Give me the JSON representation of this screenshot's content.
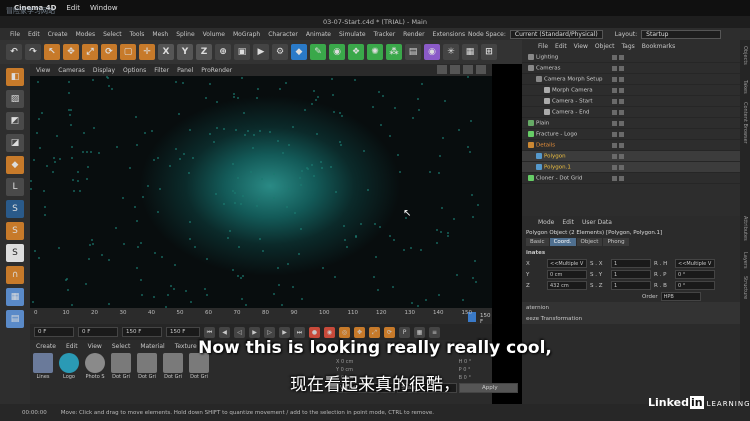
{
  "mac_menu": {
    "items": [
      "Cinema 4D",
      "Edit",
      "Window"
    ],
    "watermark": "冒险家学习网站"
  },
  "window_title": "03-07-Start.c4d * (TRIAL) - Main",
  "menu": {
    "items": [
      "File",
      "Edit",
      "Create",
      "Modes",
      "Select",
      "Tools",
      "Mesh",
      "Spline",
      "Volume",
      "MoGraph",
      "Character",
      "Animate",
      "Simulate",
      "Tracker",
      "Render",
      "Extensions"
    ],
    "node_space_label": "Node Space:",
    "node_space_value": "Current (Standard/Physical)",
    "layout_label": "Layout:",
    "layout_value": "Startup"
  },
  "toolbar": {
    "x": "X",
    "y": "Y",
    "z": "Z"
  },
  "viewport": {
    "menu": [
      "View",
      "Cameras",
      "Display",
      "Options",
      "Filter",
      "Panel",
      "ProRender"
    ]
  },
  "timeline": {
    "ticks": [
      "0",
      "10",
      "20",
      "30",
      "40",
      "50",
      "60",
      "70",
      "80",
      "90",
      "100",
      "110",
      "120",
      "130",
      "140",
      "150"
    ],
    "end_label": "150 F"
  },
  "playback": {
    "current": "0 F",
    "start": "0 F",
    "end": "150 F",
    "end2": "150 F"
  },
  "materials": {
    "menu": [
      "Create",
      "Edit",
      "View",
      "Select",
      "Material",
      "Texture"
    ],
    "items": [
      {
        "name": "Lines",
        "color": "#6a7a9a"
      },
      {
        "name": "Logo",
        "color": "#2a9ab5"
      },
      {
        "name": "Photo S",
        "color": "#8a8a8a"
      },
      {
        "name": "Dot Gri",
        "color": "#7a7a7a"
      },
      {
        "name": "Dot Gri",
        "color": "#7a7a7a"
      },
      {
        "name": "Dot Gri",
        "color": "#7a7a7a"
      },
      {
        "name": "Dot Gri",
        "color": "#7a7a7a"
      }
    ]
  },
  "coords": {
    "x": "X 0 cm",
    "y": "Y 0 cm",
    "z": "Z 0 cm",
    "h": "H 0 °",
    "p": "P 0 °",
    "b": "B 0 °",
    "world": "World",
    "scale": "Scale",
    "apply": "Apply"
  },
  "status": {
    "time": "00:00:00",
    "message": "Move: Click and drag to move elements. Hold down SHIFT to quantize movement / add to the selection in point mode, CTRL to remove."
  },
  "objects": {
    "menu": [
      "File",
      "Edit",
      "View",
      "Object",
      "Tags",
      "Bookmarks"
    ],
    "rows": [
      {
        "name": "Lighting",
        "indent": 0,
        "color": "#888"
      },
      {
        "name": "Cameras",
        "indent": 0,
        "color": "#888"
      },
      {
        "name": "Camera Morph Setup",
        "indent": 1,
        "color": "#888"
      },
      {
        "name": "Morph Camera",
        "indent": 2,
        "color": "#aaa"
      },
      {
        "name": "Camera - Start",
        "indent": 2,
        "color": "#aaa"
      },
      {
        "name": "Camera - End",
        "indent": 2,
        "color": "#aaa"
      },
      {
        "name": "Plain",
        "indent": 0,
        "color": "#6a6"
      },
      {
        "name": "Fracture - Logo",
        "indent": 0,
        "color": "#6c6"
      },
      {
        "name": "Details",
        "indent": 0,
        "color": "#c83"
      },
      {
        "name": "Polygon",
        "indent": 1,
        "color": "#59c"
      },
      {
        "name": "Polygon.1",
        "indent": 1,
        "color": "#59c"
      },
      {
        "name": "Cloner - Dot Grid",
        "indent": 0,
        "color": "#6c6"
      }
    ]
  },
  "attributes": {
    "menu": [
      "Mode",
      "Edit",
      "User Data"
    ],
    "header": "Polygon Object (2 Elements) [Polygon, Polygon.1]",
    "tabs": [
      "Basic",
      "Coord.",
      "Object",
      "Phong"
    ],
    "active_tab": "Coord.",
    "section": "inates",
    "rows": [
      {
        "a": "X",
        "av": "<<Multiple V",
        "b": "S . X",
        "bv": "1",
        "c": "R . H",
        "cv": "<<Multiple V"
      },
      {
        "a": "Y",
        "av": "0 cm",
        "b": "S . Y",
        "bv": "1",
        "c": "R . P",
        "cv": "0 °"
      },
      {
        "a": "Z",
        "av": "432 cm",
        "b": "S . Z",
        "bv": "1",
        "c": "R . B",
        "cv": "0 °"
      }
    ],
    "order_label": "Order",
    "order_value": "HPB",
    "quaternion": "aternion",
    "freeze": "eeze Transformation"
  },
  "right_strip": [
    "Objects",
    "Takes",
    "Content Browser",
    "Attributes",
    "Layers",
    "Structure"
  ],
  "subtitle": {
    "en": "Now this is looking really really cool,",
    "zh": "现在看起来真的很酷，"
  },
  "brand": {
    "name": "Linked",
    "in": "in",
    "learning": "LEARNING"
  }
}
